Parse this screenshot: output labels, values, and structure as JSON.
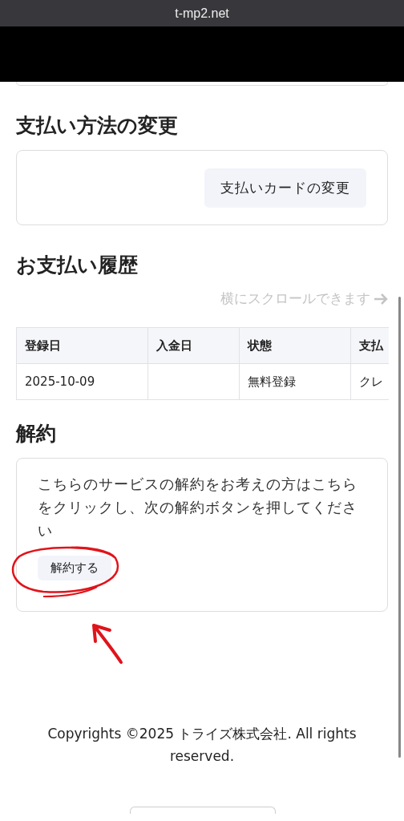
{
  "browser": {
    "address": "t-mp2.net"
  },
  "payment_method": {
    "title": "支払い方法の変更",
    "button": "支払いカードの変更"
  },
  "history": {
    "title": "お支払い履歴",
    "scroll_hint": "横にスクロールできます",
    "table": {
      "columns": [
        "登録日",
        "入金日",
        "状態",
        "支払"
      ],
      "rows": [
        {
          "cells": [
            "2025-10-09",
            null,
            "無料登録",
            "クレ"
          ]
        }
      ]
    }
  },
  "cancel": {
    "title": "解約",
    "text": "こちらのサービスの解約をお考えの方はこちらをクリックし、次の解約ボタンを押してください",
    "button": "解約する"
  },
  "footer": "Copyrights ©2025 トライズ株式会社. All rights reserved."
}
